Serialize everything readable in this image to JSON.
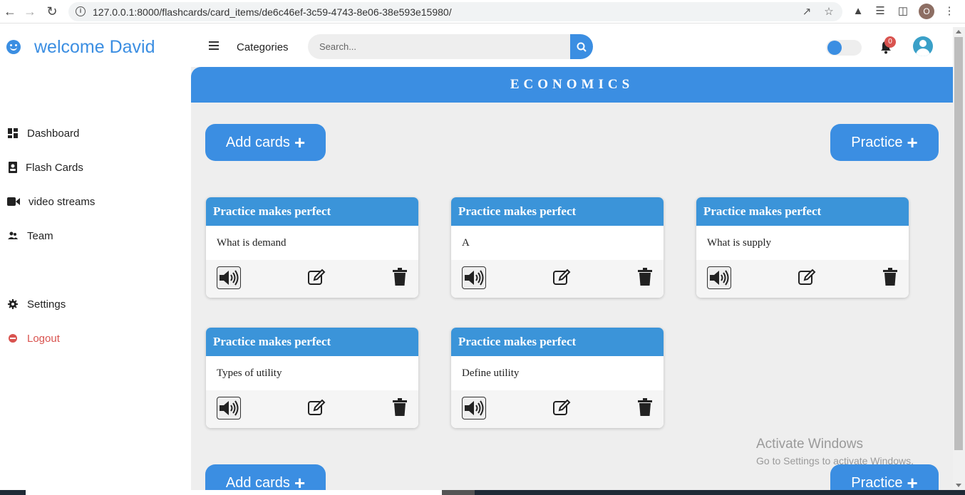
{
  "browser": {
    "url": "127.0.0.1:8000/flashcards/card_items/de6c46ef-3c59-4743-8e06-38e593e15980/",
    "profile_initial": "O"
  },
  "sidebar": {
    "welcome": "welcome David",
    "items": [
      {
        "label": "Dashboard",
        "icon": "dashboard-icon"
      },
      {
        "label": "Flash Cards",
        "icon": "flashcards-icon"
      },
      {
        "label": "video streams",
        "icon": "video-camera-icon"
      },
      {
        "label": "Team",
        "icon": "team-icon"
      },
      {
        "label": "Settings",
        "icon": "gear-icon"
      },
      {
        "label": "Logout",
        "icon": "logout-icon"
      }
    ]
  },
  "topbar": {
    "categories_label": "Categories",
    "search_placeholder": "Search...",
    "notification_count": "0"
  },
  "main": {
    "category_title": "ECONOMICS",
    "add_cards_label": "Add cards",
    "practice_label": "Practice",
    "cards": [
      {
        "title": "Practice makes perfect",
        "question": "What is demand"
      },
      {
        "title": "Practice makes perfect",
        "question": "A"
      },
      {
        "title": "Practice makes perfect",
        "question": "What is supply"
      },
      {
        "title": "Practice makes perfect",
        "question": "Types of utility"
      },
      {
        "title": "Practice makes perfect",
        "question": "Define utility"
      }
    ]
  },
  "watermark": {
    "line1": "Activate Windows",
    "line2": "Go to Settings to activate Windows."
  },
  "colors": {
    "accent": "#3b8ee2",
    "card_header": "#3b94d9",
    "logout": "#d9534f",
    "content_bg": "#eeeeee"
  }
}
